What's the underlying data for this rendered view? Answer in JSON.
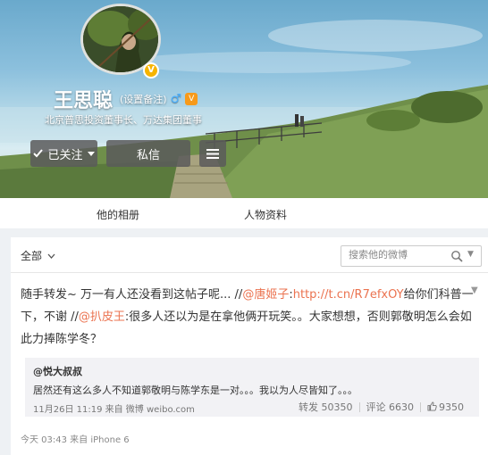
{
  "profile": {
    "name": "王思聪",
    "remark": "(设置备注)",
    "gender_icon": "♂",
    "vip_badge": "V",
    "verified_badge": "V",
    "bio": "北京普思投资董事长、万达集团董事",
    "follow_label": "已关注",
    "message_label": "私信",
    "menu_icon": "menu-icon"
  },
  "tabs": [
    {
      "label": "他的相册"
    },
    {
      "label": "人物资料"
    }
  ],
  "filter": {
    "all_label": "全部",
    "search_placeholder": "搜索他的微博"
  },
  "post": {
    "text_1": "随手转发~ 万一有人还没看到这帖子呢... //",
    "mention_1": "@唐姬子",
    "text_2": ":",
    "link": "http://t.cn/R7efxOY",
    "text_3": "给你们科普一下，不谢 //",
    "mention_2": "@扒皮王",
    "text_4": ":很多人还以为是在拿他俩开玩笑。。大家想想，否则郭敬明怎么会如此力捧陈学冬？",
    "repost": {
      "author": "@悦大叔叔",
      "text": "居然还有这么多人不知道郭敬明与陈学东是一对。。。我以为人尽皆知了。。。",
      "meta": "11月26日 11:19 来自 微博 weibo.com",
      "reposts": "转发 50350",
      "comments": "评论 6630",
      "likes": "9350"
    },
    "meta": "今天 03:43 来自 iPhone 6"
  },
  "colors": {
    "link": "#eb7350",
    "button_bg": "#5a5a5a",
    "vip": "#f79a1a",
    "verified": "#f6b400"
  }
}
